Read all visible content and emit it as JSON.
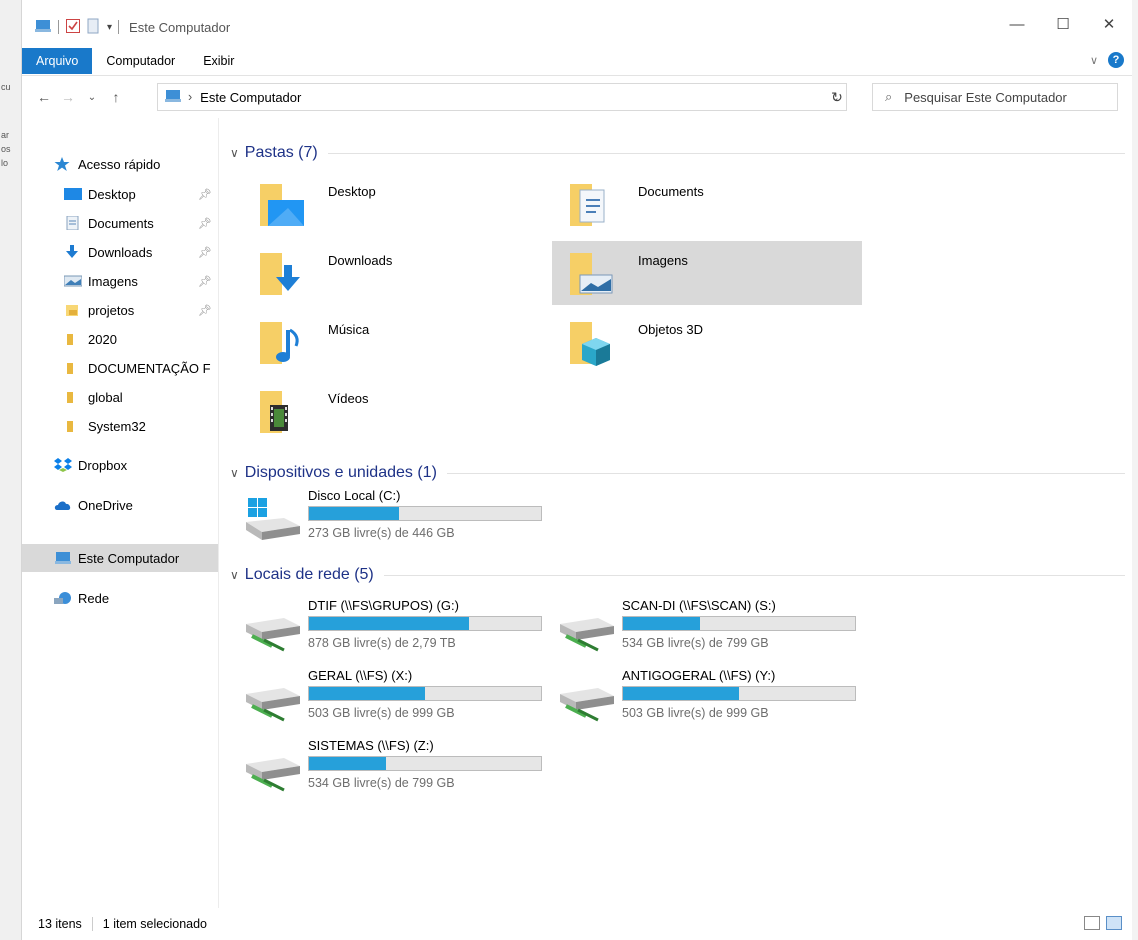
{
  "window": {
    "title": "Este Computador",
    "controls": {
      "minimize": "—",
      "maximize": "☐",
      "close": "✕"
    }
  },
  "background": {
    "fragments": [
      "cu",
      "ar",
      "os",
      "lo"
    ]
  },
  "ribbon": {
    "tabs": [
      {
        "label": "Arquivo",
        "active": true
      },
      {
        "label": "Computador",
        "active": false
      },
      {
        "label": "Exibir",
        "active": false
      }
    ],
    "help": "?"
  },
  "address": {
    "path": "Este Computador",
    "search_placeholder": "Pesquisar Este Computador"
  },
  "sidebar": {
    "items": [
      {
        "label": "Acesso rápido",
        "icon": "star-icon",
        "pinned": false
      },
      {
        "label": "Desktop",
        "icon": "desktop-folder-icon",
        "pinned": true
      },
      {
        "label": "Documents",
        "icon": "documents-folder-icon",
        "pinned": true
      },
      {
        "label": "Downloads",
        "icon": "downloads-arrow-icon",
        "pinned": true
      },
      {
        "label": "Imagens",
        "icon": "pictures-folder-icon",
        "pinned": true
      },
      {
        "label": "projetos",
        "icon": "folder-icon",
        "pinned": true
      },
      {
        "label": "2020",
        "icon": "folder-icon",
        "pinned": false
      },
      {
        "label": "DOCUMENTAÇÃO F",
        "icon": "folder-icon",
        "pinned": false
      },
      {
        "label": "global",
        "icon": "folder-icon",
        "pinned": false
      },
      {
        "label": "System32",
        "icon": "folder-icon",
        "pinned": false
      },
      {
        "label": "Dropbox",
        "icon": "dropbox-icon",
        "pinned": false
      },
      {
        "label": "OneDrive",
        "icon": "cloud-icon",
        "pinned": false
      },
      {
        "label": "Este Computador",
        "icon": "computer-icon",
        "pinned": false,
        "selected": true
      },
      {
        "label": "Rede",
        "icon": "network-icon",
        "pinned": false
      }
    ]
  },
  "groups": {
    "folders": {
      "title": "Pastas (7)"
    },
    "devices": {
      "title": "Dispositivos e unidades (1)"
    },
    "network": {
      "title": "Locais de rede (5)"
    }
  },
  "folders": [
    {
      "label": "Desktop",
      "icon": "desktop-folder-icon"
    },
    {
      "label": "Documents",
      "icon": "documents-folder-icon"
    },
    {
      "label": "Downloads",
      "icon": "downloads-folder-icon"
    },
    {
      "label": "Imagens",
      "icon": "pictures-folder-icon",
      "selected": true
    },
    {
      "label": "Música",
      "icon": "music-folder-icon"
    },
    {
      "label": "Objetos 3D",
      "icon": "3d-objects-folder-icon"
    },
    {
      "label": "Vídeos",
      "icon": "videos-folder-icon"
    }
  ],
  "devices": [
    {
      "name": "Disco Local (C:)",
      "free": "273 GB livre(s) de 446 GB",
      "used_fraction": 0.39,
      "icon": "windows-drive-icon"
    }
  ],
  "network_drives": [
    {
      "name": "DTIF (\\\\FS\\GRUPOS) (G:)",
      "free": "878 GB livre(s) de 2,79 TB",
      "used_fraction": 0.69,
      "icon": "network-drive-icon"
    },
    {
      "name": "SCAN-DI (\\\\FS\\SCAN) (S:)",
      "free": "534 GB livre(s) de 799 GB",
      "used_fraction": 0.33,
      "icon": "network-drive-icon"
    },
    {
      "name": "GERAL (\\\\FS) (X:)",
      "free": "503 GB livre(s) de 999 GB",
      "used_fraction": 0.5,
      "icon": "network-drive-icon"
    },
    {
      "name": "ANTIGOGERAL (\\\\FS) (Y:)",
      "free": "503 GB livre(s) de 999 GB",
      "used_fraction": 0.5,
      "icon": "network-drive-icon"
    },
    {
      "name": "SISTEMAS (\\\\FS) (Z:)",
      "free": "534 GB livre(s) de 799 GB",
      "used_fraction": 0.33,
      "icon": "network-drive-icon"
    }
  ],
  "status": {
    "count": "13 itens",
    "selection": "1 item selecionado"
  },
  "colors": {
    "accent": "#1979ca",
    "group_header": "#1e3287",
    "drive_bar": "#26a0da",
    "selection": "#d9d9d9"
  }
}
